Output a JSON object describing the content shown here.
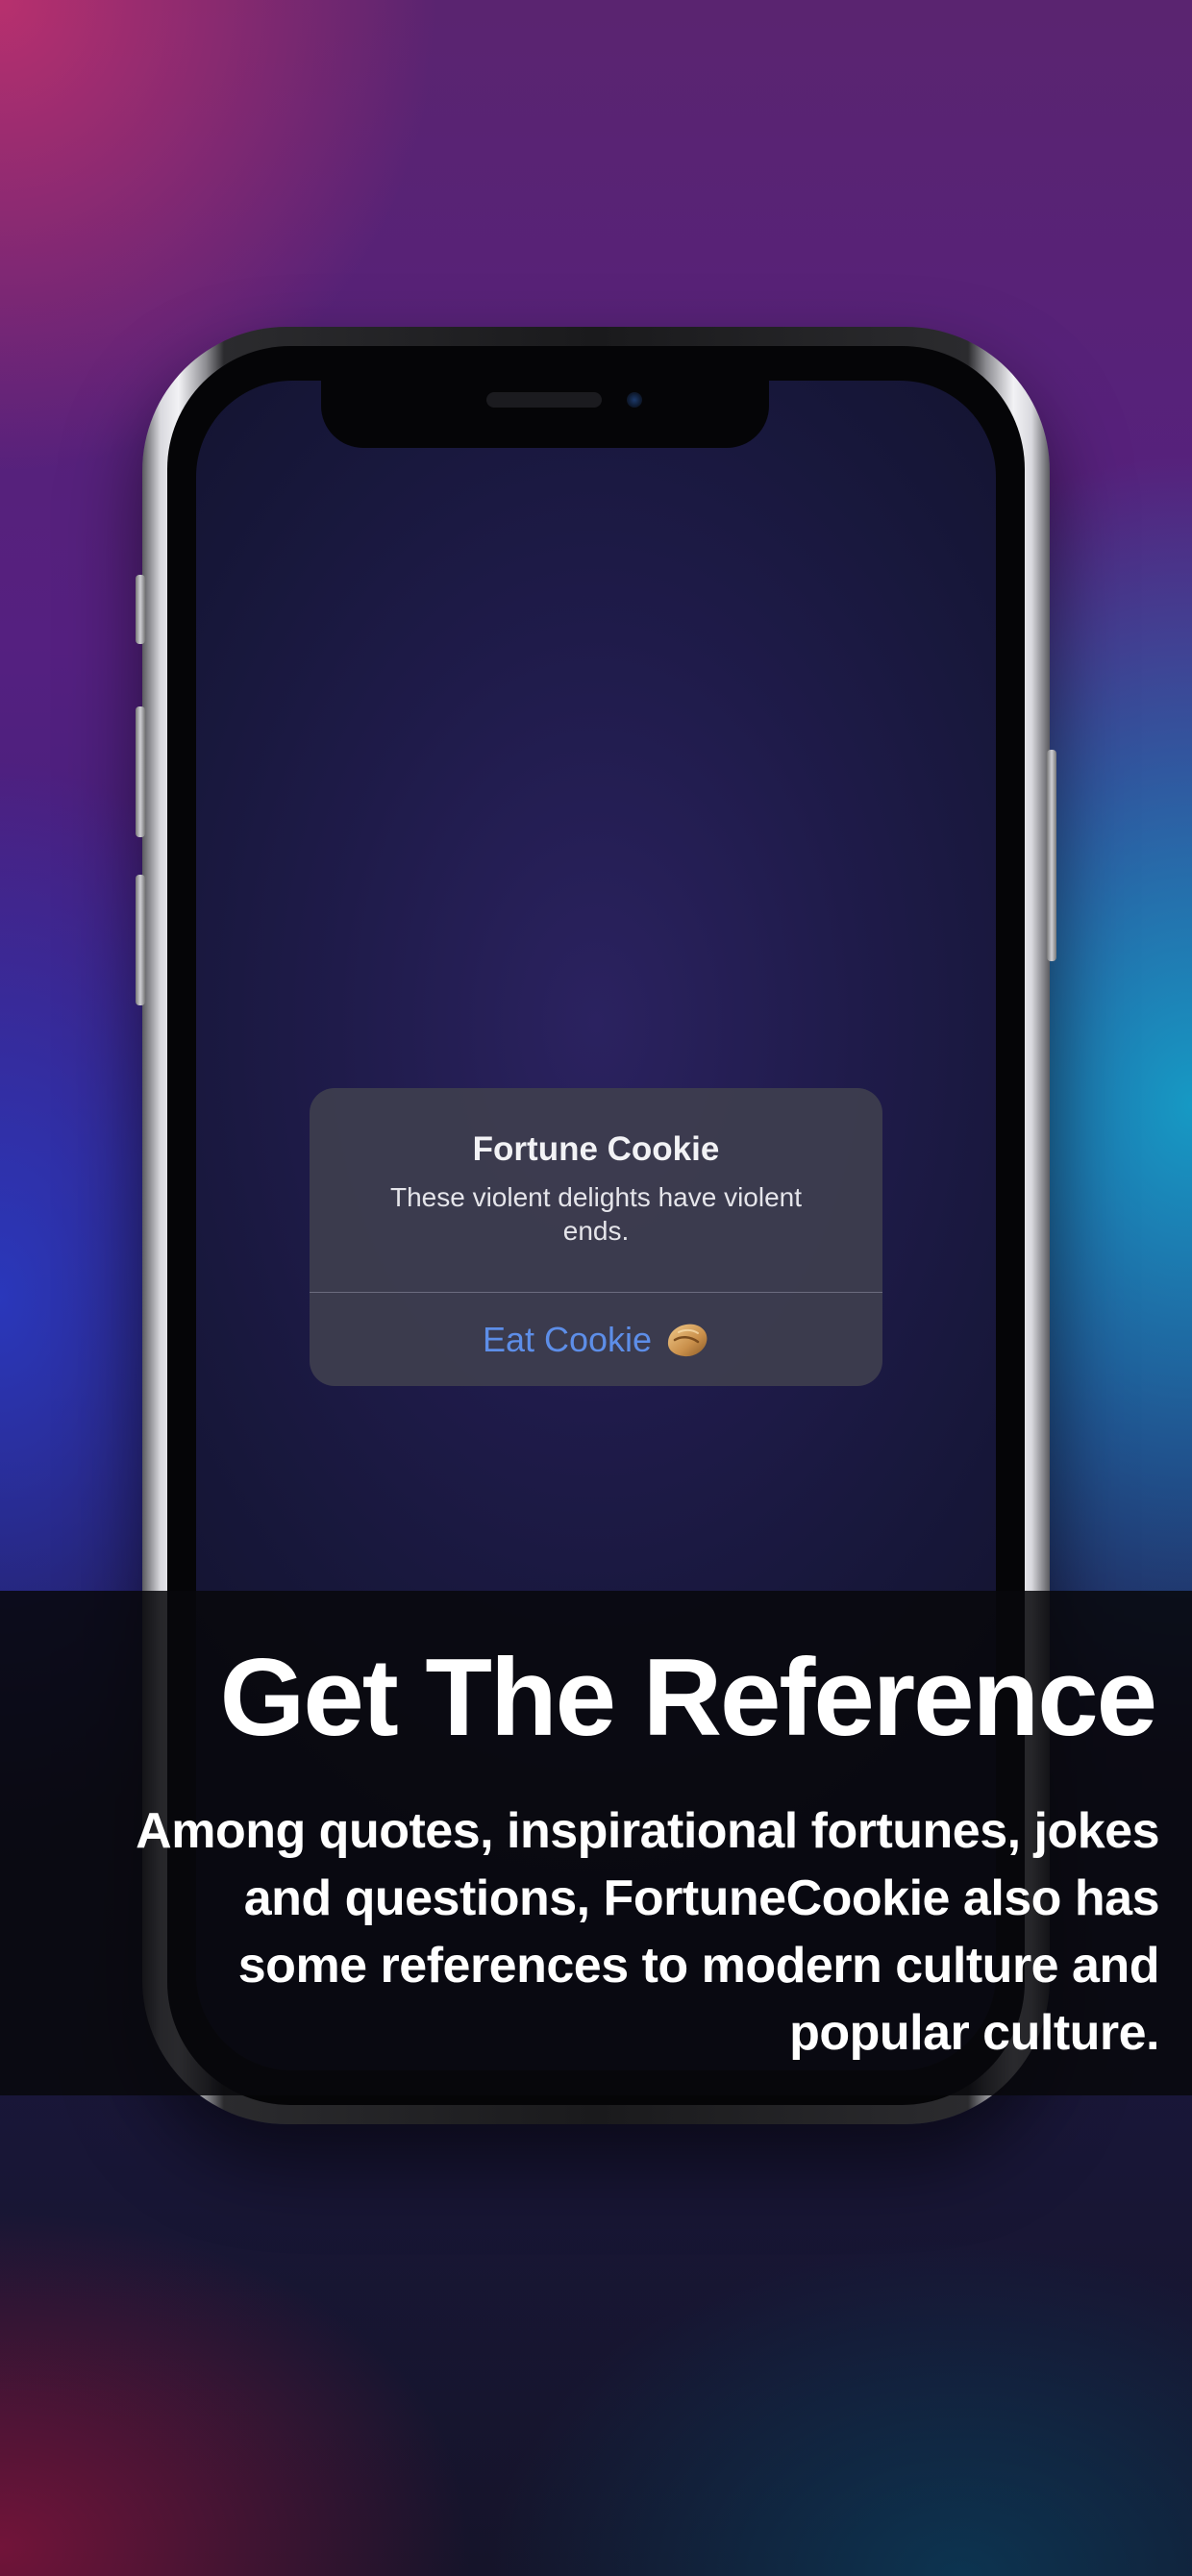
{
  "colors": {
    "accent_link": "#5d8ee8",
    "alert_background": "#3e3e4e",
    "caption_band": "#08080c",
    "headline_text": "#ffffff"
  },
  "alert": {
    "title": "Fortune Cookie",
    "message": "These violent delights have violent ends.",
    "button_label": "Eat Cookie",
    "button_icon": "fortune-cookie-icon"
  },
  "caption": {
    "headline": "Get The Reference",
    "body": "Among quotes, inspirational fortunes, jokes and questions, FortuneCookie also has some references to modern culture and popular culture."
  }
}
